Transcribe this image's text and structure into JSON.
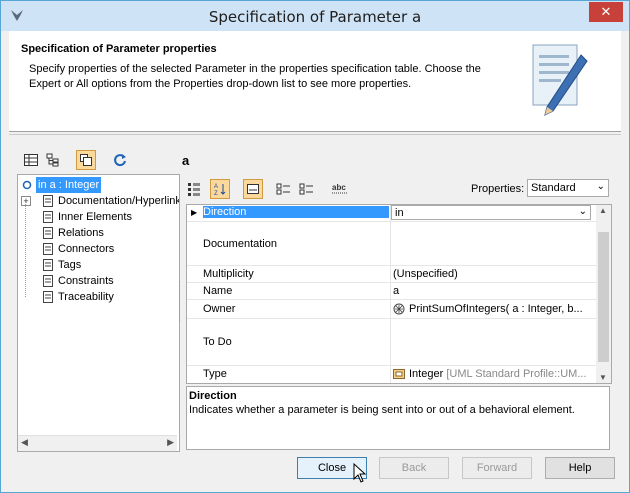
{
  "window": {
    "title": "Specification of Parameter a",
    "close_glyph": "✕"
  },
  "header": {
    "title": "Specification of Parameter properties",
    "description": "Specify properties of the selected Parameter in the properties specification table. Choose the Expert or All options from the Properties drop-down list to see more properties."
  },
  "toolbar_left": {
    "icons": [
      "table-icon",
      "tree-icon",
      "copy-icon",
      "refresh-icon"
    ]
  },
  "element_name": "a",
  "tree": {
    "items": [
      {
        "label": "in a : Integer",
        "selected": true
      },
      {
        "label": "Documentation/Hyperlinks",
        "expander": "+"
      },
      {
        "label": "Inner Elements"
      },
      {
        "label": "Relations"
      },
      {
        "label": "Connectors"
      },
      {
        "label": "Tags"
      },
      {
        "label": "Constraints"
      },
      {
        "label": "Traceability"
      }
    ]
  },
  "properties": {
    "label": "Properties:",
    "selected": "Standard"
  },
  "grid": {
    "rows": [
      {
        "name": "Direction",
        "value": "in",
        "dropdown": true,
        "selected": true
      },
      {
        "name": "Documentation",
        "value": ""
      },
      {
        "name": "Multiplicity",
        "value": "(Unspecified)"
      },
      {
        "name": "Name",
        "value": "a"
      },
      {
        "name": "Owner",
        "value": "PrintSumOfIntegers( a : Integer, b..."
      },
      {
        "name": "To Do",
        "value": ""
      },
      {
        "name": "Type",
        "value": "Integer",
        "value_suffix": "[UML Standard Profile::UM..."
      }
    ]
  },
  "description": {
    "title": "Direction",
    "text": "Indicates whether a parameter is being sent into or out of a behavioral element."
  },
  "buttons": {
    "close": "Close",
    "back": "Back",
    "forward": "Forward",
    "help": "Help"
  },
  "colors": {
    "titlebar": "#cfe3f6",
    "close_button": "#c7413a",
    "selection": "#3399ff",
    "active_tool": "#fbd89c"
  }
}
